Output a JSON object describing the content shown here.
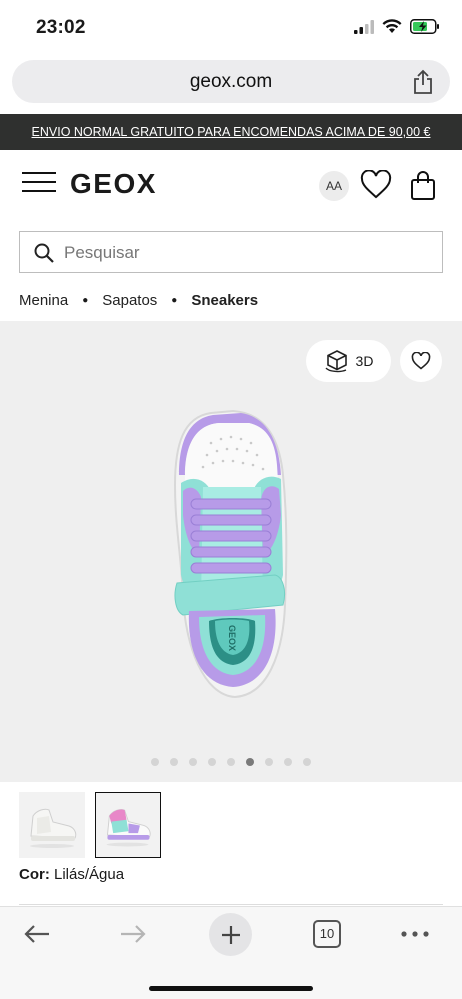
{
  "status": {
    "time": "23:02"
  },
  "browser": {
    "url": "geox.com",
    "tabs_count": "10"
  },
  "promo": {
    "text": "ENVIO NORMAL GRATUITO PARA ENCOMENDAS ACIMA DE 90,00 €"
  },
  "header": {
    "logo": "GEOX",
    "text_size_label": "AA"
  },
  "search": {
    "placeholder": "Pesquisar"
  },
  "breadcrumb": {
    "items": [
      "Menina",
      "Sapatos",
      "Sneakers"
    ]
  },
  "product": {
    "view_3d_label": "3D",
    "gallery": {
      "total": 9,
      "active_index": 5
    },
    "shoe_logo": "GEOX",
    "color_label": "Cor:",
    "color_value": "Lilás/Água"
  },
  "colors": {
    "promo_bg": "#2f302f",
    "stage_bg": "#efefef",
    "lilac": "#b79be8",
    "aqua": "#8fe0d6"
  }
}
